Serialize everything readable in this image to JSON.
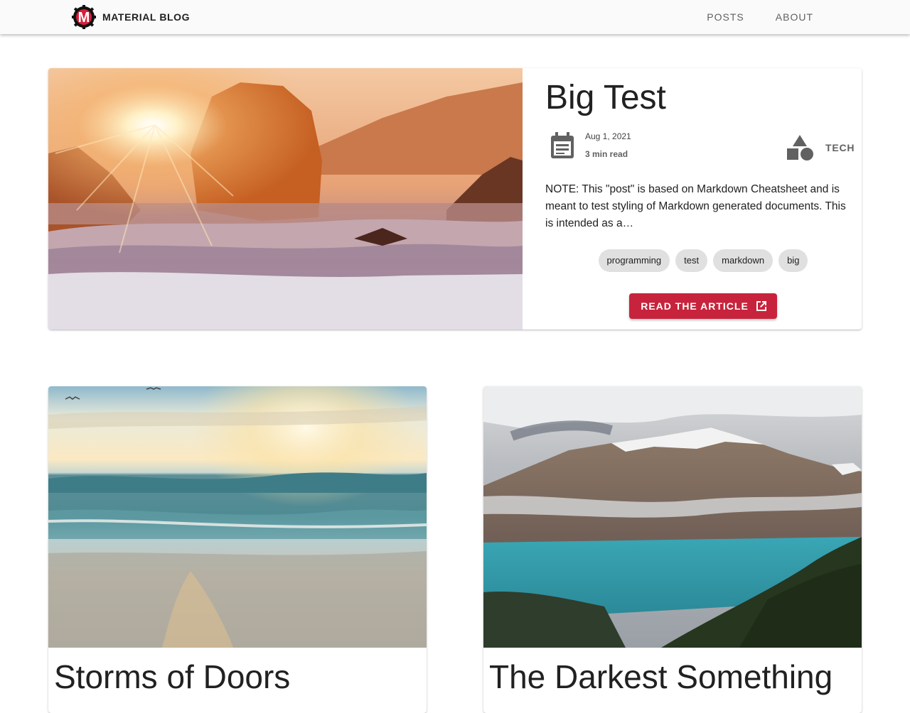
{
  "header": {
    "brand_name": "MATERIAL BLOG",
    "logo_letter": "M",
    "nav": [
      {
        "label": "POSTS"
      },
      {
        "label": "ABOUT"
      }
    ]
  },
  "featured": {
    "title": "Big Test",
    "date": "Aug 1, 2021",
    "read_time": "3 min read",
    "category": "TECH",
    "excerpt": "NOTE: This \"post\" is based on Markdown Cheatsheet and is meant to test styling of Markdown generated documents. This is intended as a…",
    "tags": [
      "programming",
      "test",
      "markdown",
      "big"
    ],
    "cta_label": "READ THE ARTICLE",
    "cta_icon": "open-in-new-icon",
    "date_icon": "event-note-icon",
    "category_icon": "category-shapes-icon"
  },
  "posts": [
    {
      "title": "Storms of Doors"
    },
    {
      "title": "The Darkest Something"
    }
  ],
  "colors": {
    "accent": "#c8233c",
    "chip_bg": "#e0e0e0",
    "appbar_bg": "#fafafa"
  }
}
